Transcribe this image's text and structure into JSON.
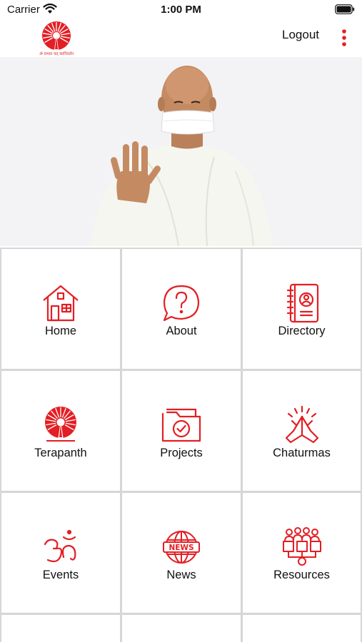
{
  "status_bar": {
    "carrier": "Carrier",
    "time": "1:00 PM"
  },
  "nav": {
    "logout_label": "Logout",
    "logo_caption": "ॐ प्रभात यत् त्रतनिवर्तन"
  },
  "colors": {
    "accent": "#e31e24",
    "tile_bg": "#ffffff",
    "divider": "#d4d4d4",
    "hero_bg": "#f3f3f5"
  },
  "menu": {
    "items": [
      {
        "label": "Home",
        "icon": "house-icon"
      },
      {
        "label": "About",
        "icon": "question-bubble-icon"
      },
      {
        "label": "Directory",
        "icon": "contact-book-icon"
      },
      {
        "label": "Terapanth",
        "icon": "terapanth-logo-icon"
      },
      {
        "label": "Projects",
        "icon": "folder-check-icon"
      },
      {
        "label": "Chaturmas",
        "icon": "folded-hands-icon"
      },
      {
        "label": "Events",
        "icon": "om-icon"
      },
      {
        "label": "News",
        "icon": "globe-news-icon"
      },
      {
        "label": "Resources",
        "icon": "people-network-icon"
      }
    ]
  }
}
